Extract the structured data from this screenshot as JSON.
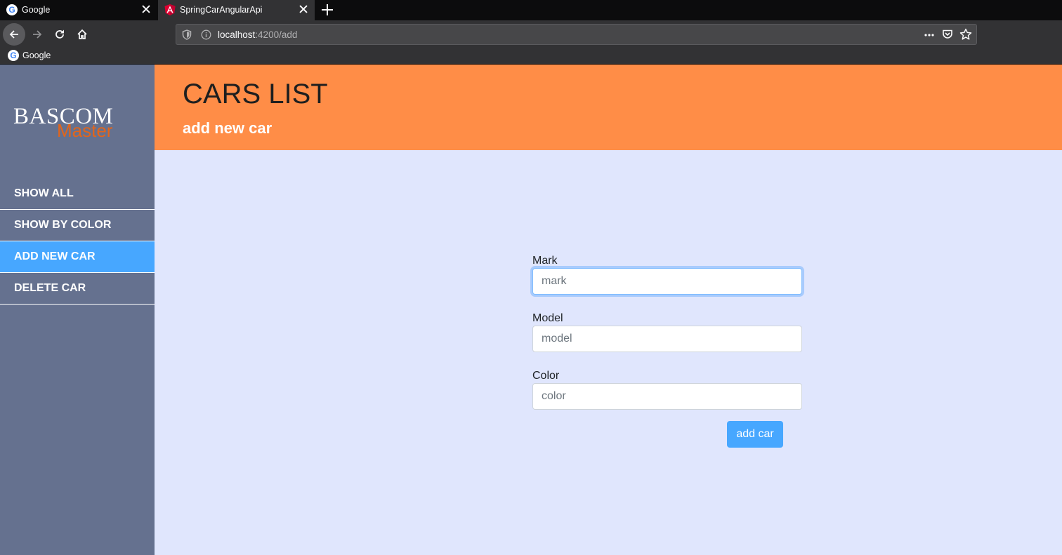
{
  "browser": {
    "tabs": [
      {
        "title": "Google",
        "active": false,
        "favicon": "google-favicon"
      },
      {
        "title": "SpringCarAngularApi",
        "active": true,
        "favicon": "angular-favicon"
      }
    ],
    "url_host": "localhost",
    "url_path": ":4200/add",
    "bookmarks": [
      {
        "label": "Google",
        "favicon": "google-favicon"
      }
    ]
  },
  "sidebar": {
    "logo_top": "BASCOM",
    "logo_bottom": "Master",
    "items": [
      {
        "label": "SHOW ALL",
        "active": false
      },
      {
        "label": "SHOW BY COLOR",
        "active": false
      },
      {
        "label": "ADD NEW CAR",
        "active": true
      },
      {
        "label": "DELETE CAR",
        "active": false
      }
    ]
  },
  "header": {
    "title": "CARS LIST",
    "subtitle": "add new car"
  },
  "form": {
    "mark_label": "Mark",
    "mark_placeholder": "mark",
    "model_label": "Model",
    "model_placeholder": "model",
    "color_label": "Color",
    "color_placeholder": "color",
    "submit_label": "add car"
  },
  "colors": {
    "header_bg": "#ff8d47",
    "sidebar_bg": "#65718f",
    "active_menu": "#47a7ff",
    "content_bg": "#e0e6fd",
    "logo_accent": "#e2651b"
  }
}
